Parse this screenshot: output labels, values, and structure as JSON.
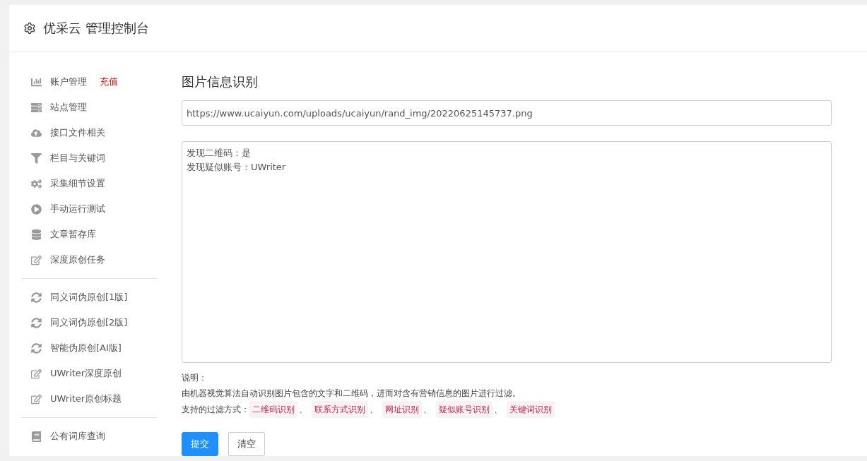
{
  "header": {
    "title": "优采云 管理控制台"
  },
  "sidebar": {
    "groups": [
      {
        "items": [
          {
            "label": "账户管理",
            "link": "充值"
          },
          {
            "label": "站点管理"
          },
          {
            "label": "接口文件相关"
          },
          {
            "label": "栏目与关键词"
          },
          {
            "label": "采集细节设置"
          },
          {
            "label": "手动运行测试"
          },
          {
            "label": "文章暂存库"
          },
          {
            "label": "深度原创任务"
          }
        ]
      },
      {
        "items": [
          {
            "label": "同义词伪原创[1版]"
          },
          {
            "label": "同义词伪原创[2版]"
          },
          {
            "label": "智能伪原创[AI版]"
          },
          {
            "label": "UWriter深度原创"
          },
          {
            "label": "UWriter原创标题"
          }
        ]
      },
      {
        "items": [
          {
            "label": "公有词库查询"
          }
        ]
      }
    ]
  },
  "main": {
    "title": "图片信息识别",
    "url_field": {
      "value": "https://www.ucaiyun.com/uploads/ucaiyun/rand_img/20220625145737.png"
    },
    "result_box": {
      "lines": [
        "发现二维码：是",
        "发现疑似账号：UWriter"
      ]
    },
    "notes": {
      "heading": "说明：",
      "description": "由机器视觉算法自动识别图片包含的文字和二维码，进而对含有营销信息的图片进行过滤。",
      "methods_label": "支持的过滤方式：",
      "separator": "、",
      "methods": [
        "二维码识别",
        "联系方式识别",
        "网址识别",
        "疑似账号识别",
        "关键词识别"
      ]
    },
    "buttons": [
      {
        "label": "提交",
        "kind": "primary"
      },
      {
        "label": "清空",
        "kind": "default"
      }
    ]
  }
}
